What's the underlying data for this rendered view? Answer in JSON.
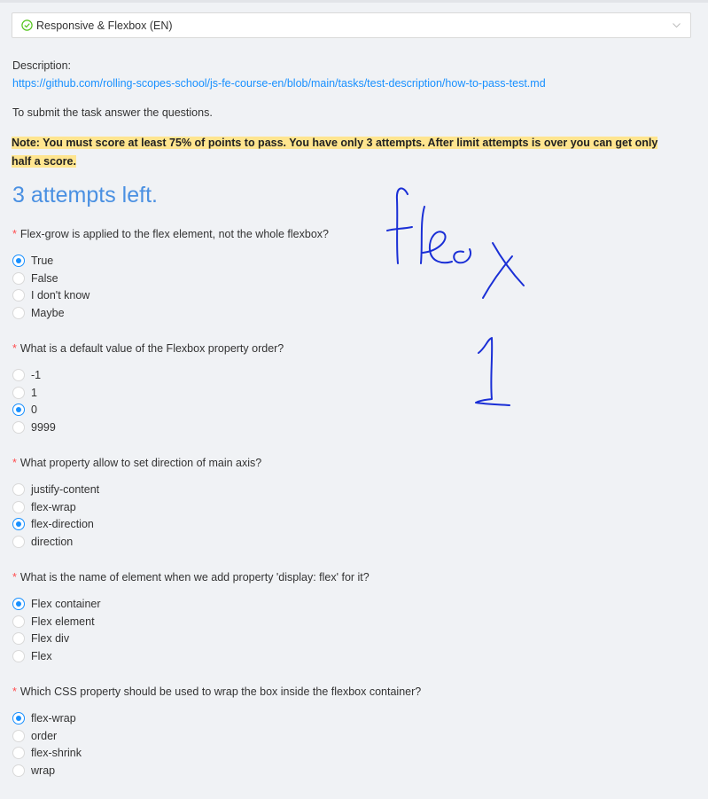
{
  "header": {
    "course_select": "Responsive & Flexbox (EN)"
  },
  "description": {
    "label": "Description:",
    "link": "https://github.com/rolling-scopes-school/js-fe-course-en/blob/main/tasks/test-description/how-to-pass-test.md"
  },
  "submit_text": "To submit the task answer the questions.",
  "note": "Note: You must score at least 75% of points to pass. You have only 3 attempts. After limit attempts is over you can get only half a score.",
  "attempts": "3 attempts left.",
  "questions": [
    {
      "text": "Flex-grow is applied to the flex element, not the whole flexbox?",
      "options": [
        "True",
        "False",
        "I don't know",
        "Maybe"
      ],
      "selected": 0
    },
    {
      "text": "What is a default value of the Flexbox property order?",
      "options": [
        "-1",
        "1",
        "0",
        "9999"
      ],
      "selected": 2
    },
    {
      "text": "What property allow to set direction of main axis?",
      "options": [
        "justify-content",
        "flex-wrap",
        "flex-direction",
        "direction"
      ],
      "selected": 2
    },
    {
      "text": "What is the name of element when we add property 'display: flex' for it?",
      "options": [
        "Flex container",
        "Flex element",
        "Flex div",
        "Flex"
      ],
      "selected": 0
    },
    {
      "text": "Which CSS property should be used to wrap the box inside the flexbox container?",
      "options": [
        "flex-wrap",
        "order",
        "flex-shrink",
        "wrap"
      ],
      "selected": 0
    }
  ],
  "colors": {
    "accent": "#1890ff",
    "heading": "#4a90e2",
    "highlight": "#ffe58f",
    "required": "#ff4d4f",
    "ink": "#1a2fd6"
  }
}
